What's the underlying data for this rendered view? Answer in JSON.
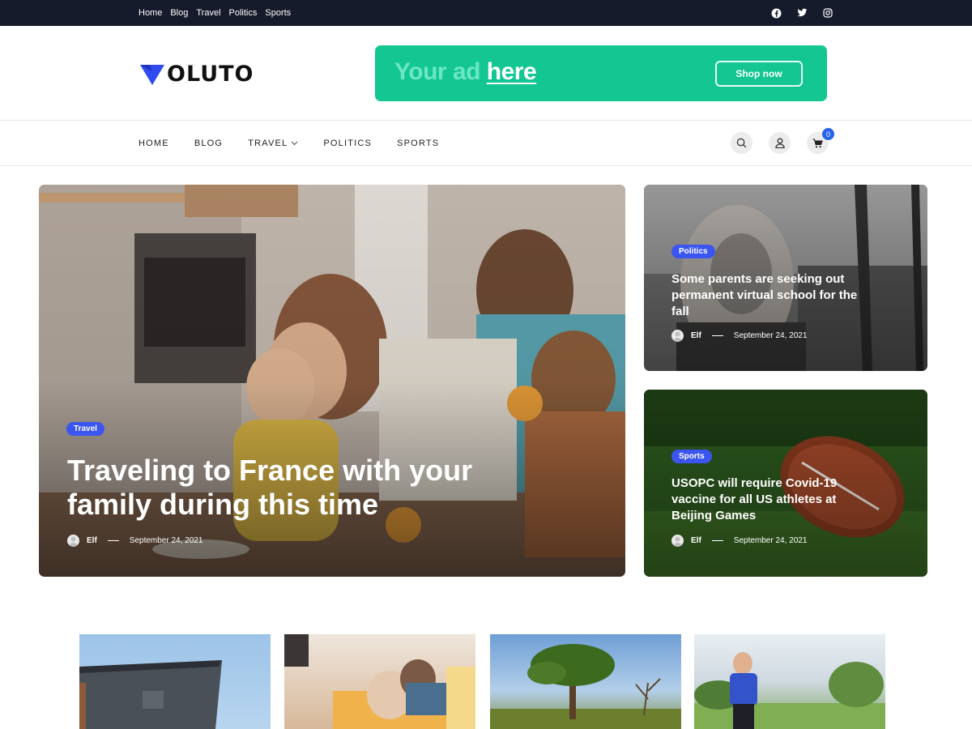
{
  "topbar": {
    "links": [
      "Home",
      "Blog",
      "Travel",
      "Politics",
      "Sports"
    ],
    "social_icons": [
      "facebook-icon",
      "twitter-icon",
      "instagram-icon"
    ]
  },
  "header": {
    "logo_text": "OLUTO",
    "ad": {
      "text_prefix": "Your ad",
      "text_highlight": "here",
      "button_label": "Shop now",
      "color": "#13c692"
    }
  },
  "nav": {
    "items": [
      "HOME",
      "BLOG",
      "TRAVEL",
      "POLITICS",
      "SPORTS"
    ],
    "cart_count": "0",
    "accent": "#2563eb"
  },
  "featured": {
    "main": {
      "tag": "Travel",
      "title": "Traveling to France with your family during this time",
      "author": "Elf",
      "date": "September 24, 2021"
    },
    "side": [
      {
        "tag": "Politics",
        "title": "Some parents are seeking out permanent virtual school for the fall",
        "author": "Elf",
        "date": "September 24, 2021"
      },
      {
        "tag": "Sports",
        "title": "USOPC will require Covid-19 vaccine for all US athletes at Beijing Games",
        "author": "Elf",
        "date": "September 24, 2021"
      }
    ]
  },
  "tag_color": "#3b55f0"
}
